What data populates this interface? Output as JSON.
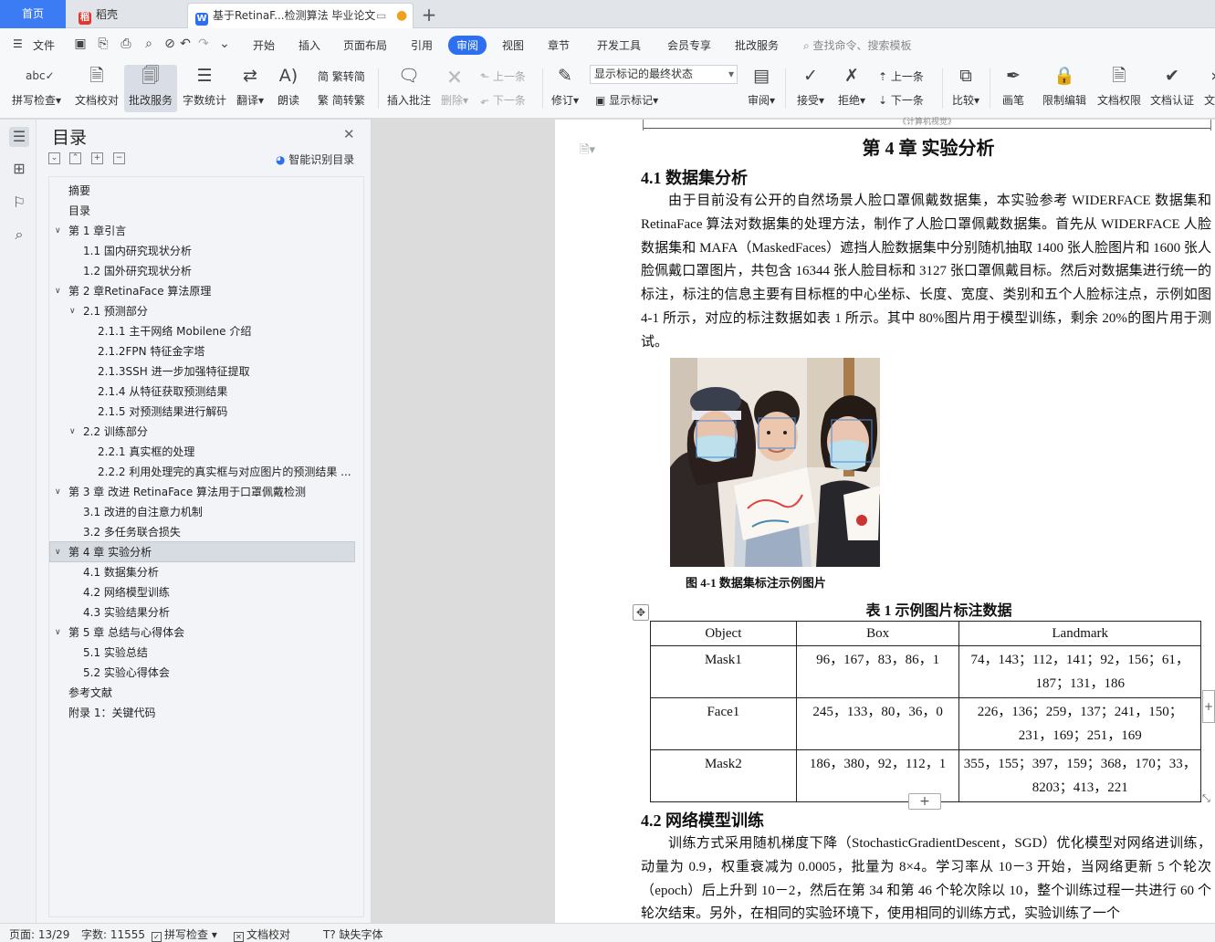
{
  "tabs": {
    "home": "首页",
    "daoke": "稻壳",
    "document": "基于RetinaF...检测算法 毕业论文",
    "add": "+"
  },
  "menubar": {
    "file": "文件",
    "items": [
      "开始",
      "插入",
      "页面布局",
      "引用",
      "审阅",
      "视图",
      "章节",
      "开发工具",
      "会员专享",
      "批改服务"
    ],
    "active": "审阅",
    "search": "查找命令、搜索模板"
  },
  "toolbar": {
    "spell_check": "拼写检查",
    "doc_proof": "文档校对",
    "correction_service": "批改服务",
    "word_count": "字数统计",
    "translate": "翻译",
    "read_aloud": "朗读",
    "trad_to_simp": "繁转简",
    "simp_to_trad": "简转繁",
    "insert_comment": "插入批注",
    "delete": "删除",
    "prev_comment": "上一条",
    "next_comment": "下一条",
    "track_changes": "修订",
    "markup_dropdown": "显示标记的最终状态",
    "show_markup": "显示标记",
    "review": "审阅",
    "accept": "接受",
    "reject": "拒绝",
    "prev_change": "上一条",
    "next_change": "下一条",
    "compare": "比较",
    "ink": "画笔",
    "restrict_edit": "限制编辑",
    "doc_permission": "文档权限",
    "doc_certify": "文档认证",
    "more": "文"
  },
  "toc": {
    "title": "目录",
    "smart": "智能识别目录",
    "items": [
      {
        "label": "摘要",
        "level": 1,
        "arrow": ""
      },
      {
        "label": "目录",
        "level": 1,
        "arrow": ""
      },
      {
        "label": "第 1 章引言",
        "level": 1,
        "arrow": "v"
      },
      {
        "label": "1.1 国内研究现状分析",
        "level": 2,
        "arrow": ""
      },
      {
        "label": "1.2 国外研究现状分析",
        "level": 2,
        "arrow": ""
      },
      {
        "label": "第 2 章RetinaFace 算法原理",
        "level": 1,
        "arrow": "v"
      },
      {
        "label": "2.1 预测部分",
        "level": 2,
        "arrow": "v"
      },
      {
        "label": "2.1.1 主干网络 Mobilene 介绍",
        "level": 3,
        "arrow": ""
      },
      {
        "label": "2.1.2FPN 特征金字塔",
        "level": 3,
        "arrow": ""
      },
      {
        "label": "2.1.3SSH 进一步加强特征提取",
        "level": 3,
        "arrow": ""
      },
      {
        "label": "2.1.4 从特征获取预测结果",
        "level": 3,
        "arrow": ""
      },
      {
        "label": "2.1.5 对预测结果进行解码",
        "level": 3,
        "arrow": ""
      },
      {
        "label": "2.2 训练部分",
        "level": 2,
        "arrow": "v"
      },
      {
        "label": "2.2.1 真实框的处理",
        "level": 3,
        "arrow": ""
      },
      {
        "label": "2.2.2 利用处理完的真实框与对应图片的预测结果 ...",
        "level": 3,
        "arrow": ""
      },
      {
        "label": "第 3 章 改进 RetinaFace 算法用于口罩佩戴检测",
        "level": 1,
        "arrow": "v"
      },
      {
        "label": "3.1 改进的自注意力机制",
        "level": 2,
        "arrow": ""
      },
      {
        "label": "3.2 多任务联合损失",
        "level": 2,
        "arrow": ""
      },
      {
        "label": "第 4 章 实验分析",
        "level": 1,
        "arrow": "v"
      },
      {
        "label": "4.1 数据集分析",
        "level": 2,
        "arrow": ""
      },
      {
        "label": "4.2 网络模型训练",
        "level": 2,
        "arrow": ""
      },
      {
        "label": "4.3 实验结果分析",
        "level": 2,
        "arrow": ""
      },
      {
        "label": "第 5 章 总结与心得体会",
        "level": 1,
        "arrow": "v"
      },
      {
        "label": "5.1 实验总结",
        "level": 2,
        "arrow": ""
      },
      {
        "label": "5.2 实验心得体会",
        "level": 2,
        "arrow": ""
      },
      {
        "label": "参考文献",
        "level": 1,
        "arrow": ""
      },
      {
        "label": "附录 1：关键代码",
        "level": 1,
        "arrow": ""
      }
    ]
  },
  "document": {
    "header": "《计算机视觉》",
    "chapter_title": "第 4 章  实验分析",
    "section1": "4.1 数据集分析",
    "para1": "由于目前没有公开的自然场景人脸口罩佩戴数据集，本实验参考 WIDERFACE 数据集和 RetinaFace 算法对数据集的处理方法，制作了人脸口罩佩戴数据集。首先从 WIDERFACE 人脸数据集和 MAFA（MaskedFaces）遮挡人脸数据集中分别随机抽取 1400 张人脸图片和 1600 张人脸佩戴口罩图片，共包含 16344 张人脸目标和 3127 张口罩佩戴目标。然后对数据集进行统一的标注，标注的信息主要有目标框的中心坐标、长度、宽度、类别和五个人脸标注点，示例如图 4-1 所示，对应的标注数据如表 1 所示。其中 80%图片用于模型训练，剩余 20%的图片用于测试。",
    "figure_caption": "图 4-1    数据集标注示例图片",
    "table_title": "表 1 示例图片标注数据",
    "table": {
      "headers": [
        "Object",
        "Box",
        "Landmark"
      ],
      "rows": [
        [
          "Mask1",
          "96，167，83，86，1",
          "74，143；112，141；92，156；61，187；131，186"
        ],
        [
          "Face1",
          "245，133，80，36，0",
          "226，136；259，137；241，150；231，169；251，169"
        ],
        [
          "Mask2",
          "186，380，92，112，1",
          "355，155；397，159；368，170；33，8203；413，221"
        ]
      ]
    },
    "section2": "4.2 网络模型训练",
    "para2": "训练方式采用随机梯度下降（StochasticGradientDescent，SGD）优化模型对网络进训练，动量为 0.9，权重衰减为 0.0005，批量为 8×4。学习率从 10－3 开始，当网络更新 5 个轮次（epoch）后上升到 10－2，然后在第 34 和第 46 个轮次除以 10，整个训练过程一共进行 60 个轮次结束。另外，在相同的实验环境下，使用相同的训练方式，实验训练了一个"
  },
  "status": {
    "page": "页面: 13/29",
    "words": "字数: 11555",
    "spell": "拼写检查",
    "proof": "文档校对",
    "missing_font": "缺失字体"
  }
}
